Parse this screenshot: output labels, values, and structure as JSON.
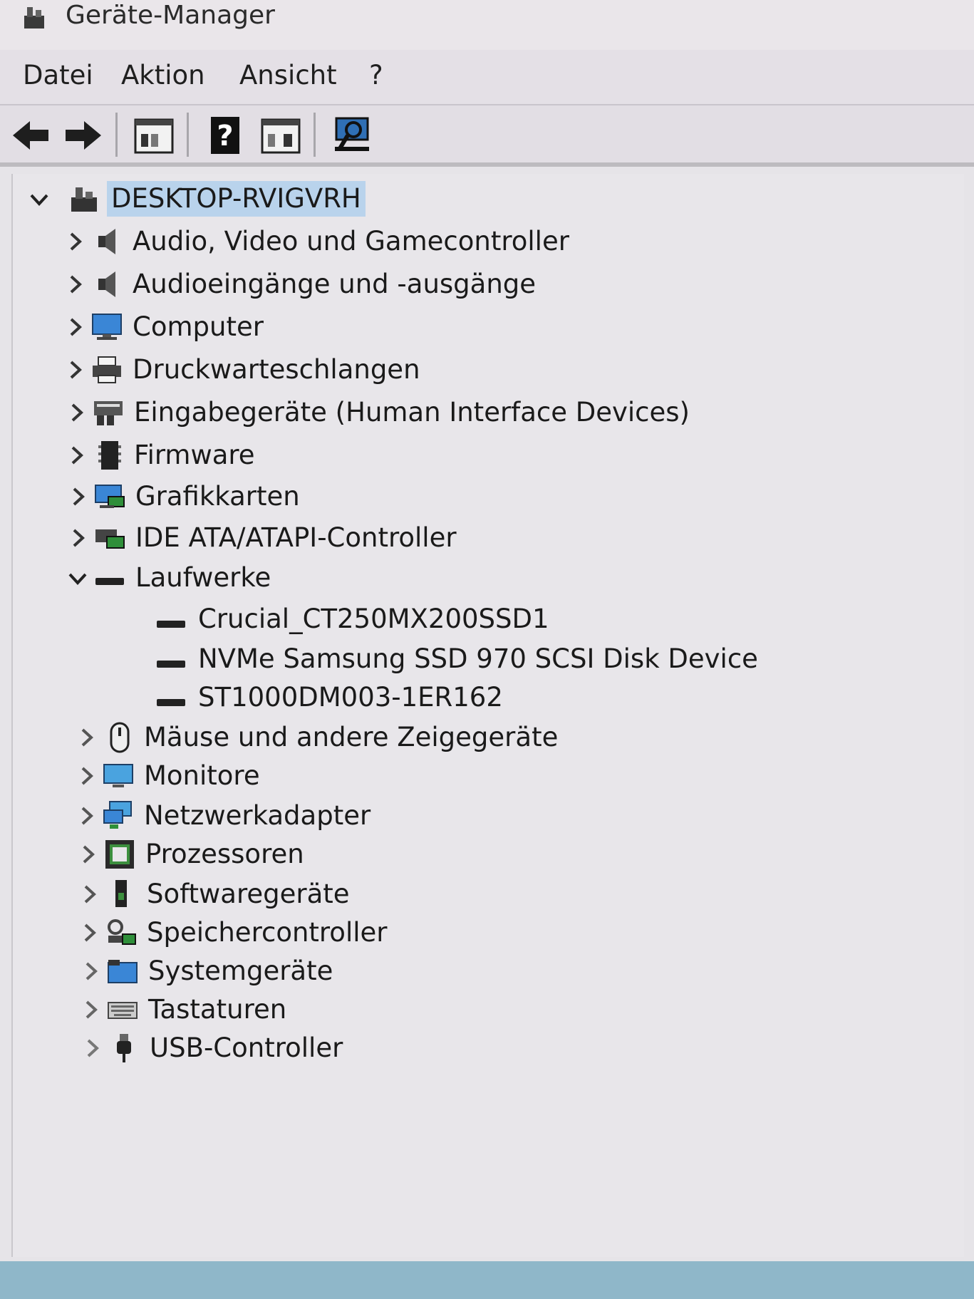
{
  "window": {
    "title": "Geräte-Manager"
  },
  "menubar": {
    "items": [
      {
        "label": "Datei"
      },
      {
        "label": "Aktion"
      },
      {
        "label": "Ansicht"
      },
      {
        "label": "?"
      }
    ]
  },
  "toolbar": {
    "buttons": [
      {
        "icon": "back-arrow-icon"
      },
      {
        "icon": "forward-arrow-icon"
      },
      {
        "icon": "properties-view-icon"
      },
      {
        "icon": "help-icon"
      },
      {
        "icon": "update-view-icon"
      },
      {
        "icon": "scan-hardware-icon"
      }
    ]
  },
  "tree": {
    "root": {
      "label": "DESKTOP-RVIGVRH",
      "expanded": true
    },
    "categories": [
      {
        "label": "Audio, Video und Gamecontroller",
        "icon": "speaker-icon"
      },
      {
        "label": "Audioeingänge und -ausgänge",
        "icon": "speaker-icon"
      },
      {
        "label": "Computer",
        "icon": "monitor-icon"
      },
      {
        "label": "Druckwarteschlangen",
        "icon": "printer-icon"
      },
      {
        "label": "Eingabegeräte (Human Interface Devices)",
        "icon": "hid-icon"
      },
      {
        "label": "Firmware",
        "icon": "chip-icon"
      },
      {
        "label": "Grafikkarten",
        "icon": "display-adapter-icon"
      },
      {
        "label": "IDE ATA/ATAPI-Controller",
        "icon": "ide-controller-icon"
      },
      {
        "label": "Laufwerke",
        "icon": "drive-icon",
        "expanded": true,
        "children": [
          {
            "label": "Crucial_CT250MX200SSD1"
          },
          {
            "label": "NVMe Samsung SSD 970 SCSI Disk Device"
          },
          {
            "label": "ST1000DM003-1ER162"
          }
        ]
      },
      {
        "label": "Mäuse und andere Zeigegeräte",
        "icon": "mouse-icon"
      },
      {
        "label": "Monitore",
        "icon": "monitor-icon"
      },
      {
        "label": "Netzwerkadapter",
        "icon": "network-icon"
      },
      {
        "label": "Prozessoren",
        "icon": "processor-icon"
      },
      {
        "label": "Softwaregeräte",
        "icon": "software-device-icon"
      },
      {
        "label": "Speichercontroller",
        "icon": "storage-controller-icon"
      },
      {
        "label": "Systemgeräte",
        "icon": "folder-icon"
      },
      {
        "label": "Tastaturen",
        "icon": "keyboard-icon"
      },
      {
        "label": "USB-Controller",
        "icon": "usb-icon"
      }
    ]
  }
}
